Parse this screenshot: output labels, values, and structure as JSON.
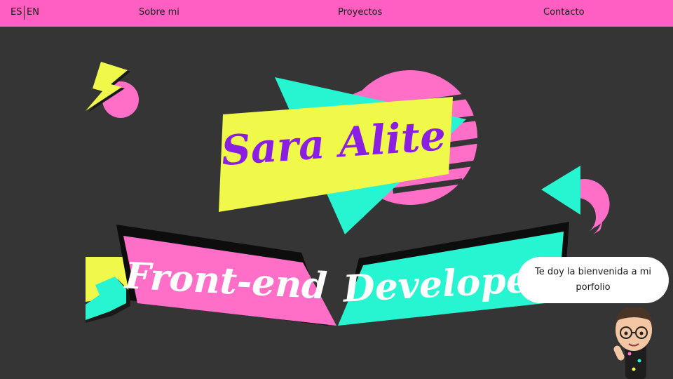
{
  "nav": {
    "lang_es": "ES",
    "lang_en": "EN",
    "links": [
      "Sobre mi",
      "Proyectos",
      "Contacto"
    ]
  },
  "hero": {
    "name": "Sara Alite",
    "role_left": "Front-end",
    "role_right": "Developer"
  },
  "speech_bubble": "Te doy la bienvenida a mi porfolio",
  "icons": [
    "lightning-bolt-icon",
    "avatar-character-icon"
  ],
  "colors": {
    "navbar": "#ff5fc0",
    "background": "#353535",
    "pink": "#ff6ec7",
    "turquoise": "#27f5d2",
    "yellow": "#f0f84a",
    "purple": "#8b1ee3"
  }
}
